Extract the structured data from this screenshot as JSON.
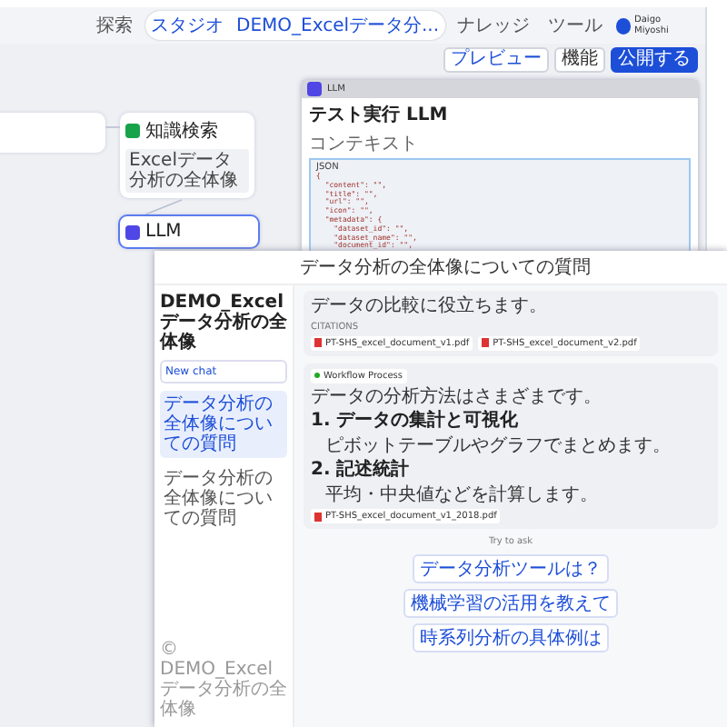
{
  "top_bar": {
    "nav": [
      {
        "label": "探索",
        "selected": false
      },
      {
        "label": "スタジオ",
        "selected": true,
        "app_name": "DEMO_Excelデータ分..."
      },
      {
        "label": "ナレッジ",
        "selected": false
      },
      {
        "label": "ツール",
        "selected": false
      }
    ],
    "user": "Daigo Miyoshi"
  },
  "toolbar": {
    "buttons": [
      {
        "label": "プレビュー",
        "kind": "outline"
      },
      {
        "label": "機能",
        "kind": "plain"
      },
      {
        "label": "公開する",
        "kind": "primary"
      }
    ]
  },
  "nodes": [
    {
      "kind": "start"
    },
    {
      "kind": "knowledge",
      "title": "知識検索",
      "chip": "Excelデータ分析の全体像"
    },
    {
      "kind": "llm",
      "title": "LLM"
    }
  ],
  "panel": {
    "header": "LLM",
    "title": "テスト実行 LLM",
    "section": "コンテキスト",
    "code_label": "JSON",
    "code": [
      "{",
      "  \"content\": \"\",",
      "  \"title\": \"\",",
      "  \"url\": \"\",",
      "  \"icon\": \"\",",
      "  \"metadata\": {",
      "    \"dataset_id\": \"\",",
      "    \"dataset_name\": \"\",",
      "    \"document_id\": \"\","
    ]
  },
  "chat": {
    "header": "データ分析の全体像についての質問",
    "sidebar": {
      "app_title": "DEMO_Excelデータ分析の全体像",
      "new_chat": "New chat",
      "conversations": [
        {
          "label": "データ分析の全体像についての質問",
          "selected": true
        },
        {
          "label": "データ分析の全体像についての質問",
          "selected": false
        }
      ],
      "footer": "© DEMO_Excelデータ分析の全体像"
    },
    "messages": [
      {
        "kind": "answer",
        "text": "データの比較に役立ちます。",
        "citations_label": "CITATIONS",
        "files": [
          "PT-SHS_excel_document_v1.pdf",
          "PT-SHS_excel_document_v2.pdf"
        ]
      },
      {
        "kind": "workflow",
        "workflow": "Workflow Process",
        "text": "データの分析方法はさまざまです。",
        "items": [
          {
            "kind": "heading",
            "text": "1. データの集計と可視化"
          },
          {
            "kind": "bullet",
            "text": "ピボットテーブルやグラフでまとめます。"
          },
          {
            "kind": "heading",
            "text": "2. 記述統計"
          },
          {
            "kind": "bullet",
            "text": "平均・中央値などを計算します。"
          }
        ],
        "files": [
          "PT-SHS_excel_document_v1_2018.pdf"
        ]
      }
    ],
    "try_label": "Try to ask",
    "suggestions": [
      "データ分析ツールは？",
      "機械学習の活用を教えて",
      "時系列分析の具体例は"
    ]
  }
}
